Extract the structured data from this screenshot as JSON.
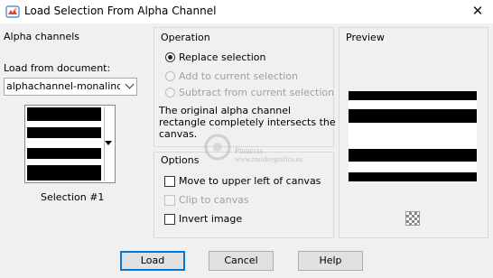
{
  "window": {
    "title": "Load Selection From Alpha Channel",
    "close_glyph": "✕"
  },
  "alpha_channels": {
    "title": "Alpha channels",
    "load_from_label": "Load from document:",
    "document_value": "alphachannel-monalinda",
    "selection_label": "Selection #1"
  },
  "operation": {
    "title": "Operation",
    "options": [
      {
        "label": "Replace selection",
        "selected": true,
        "enabled": true
      },
      {
        "label": "Add to current selection",
        "selected": false,
        "enabled": false
      },
      {
        "label": "Subtract from current selection",
        "selected": false,
        "enabled": false
      }
    ],
    "description": "The original alpha channel rectangle completely intersects the canvas.",
    "description_lines": [
      "The original alpha channel",
      "rectangle completely intersects the",
      "canvas."
    ]
  },
  "options": {
    "title": "Options",
    "items": [
      {
        "label": "Move to upper left of canvas",
        "checked": false,
        "enabled": true
      },
      {
        "label": "Clip to canvas",
        "checked": false,
        "enabled": false
      },
      {
        "label": "Invert image",
        "checked": false,
        "enabled": true
      }
    ]
  },
  "preview": {
    "title": "Preview"
  },
  "watermark": {
    "line1": "Pinuccia",
    "line2": "www.maidiregrafica.eu"
  },
  "buttons": {
    "load": "Load",
    "cancel": "Cancel",
    "help": "Help"
  },
  "colors": {
    "accent": "#0078d7",
    "panel_border": "#dadada",
    "disabled_text": "#a0a0a0"
  }
}
